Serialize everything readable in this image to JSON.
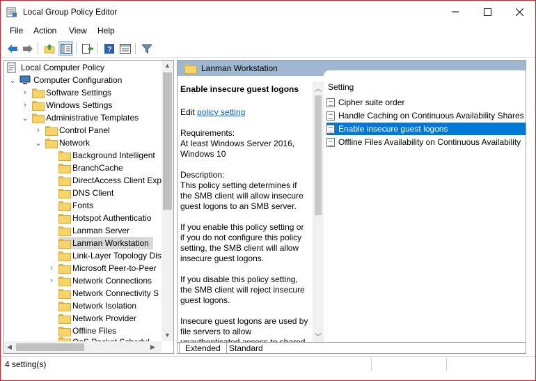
{
  "window": {
    "title": "Local Group Policy Editor"
  },
  "menu": [
    "File",
    "Action",
    "View",
    "Help"
  ],
  "toolbar": {
    "icons": [
      "back-icon",
      "forward-icon",
      "up-folder-icon",
      "show-hide-tree-icon",
      "export-list-icon",
      "help-icon",
      "properties-icon",
      "filter-icon"
    ]
  },
  "tree": {
    "root": "Local Computer Policy",
    "computer_config": "Computer Configuration",
    "software_settings": "Software Settings",
    "windows_settings": "Windows Settings",
    "admin_templates": "Administrative Templates",
    "control_panel": "Control Panel",
    "network": "Network",
    "items": [
      "Background Intelligent",
      "BranchCache",
      "DirectAccess Client Exp",
      "DNS Client",
      "Fonts",
      "Hotspot Authenticatio",
      "Lanman Server",
      "Lanman Workstation",
      "Link-Layer Topology Dis",
      "Microsoft Peer-to-Peer",
      "Network Connections",
      "Network Connectivity S",
      "Network Isolation",
      "Network Provider",
      "Offline Files",
      "QoS Packet Schedul"
    ]
  },
  "right": {
    "header": "Lanman Workstation",
    "desc": {
      "title": "Enable insecure guest logons",
      "edit_prefix": "Edit",
      "edit_link": "policy setting",
      "requirements_label": "Requirements:",
      "requirements_text": "At least Windows Server 2016, Windows 10",
      "description_label": "Description:",
      "p1": "This policy setting determines if the SMB client will allow insecure guest logons to an SMB server.",
      "p2": "If you enable this policy setting or if you do not configure this policy setting, the SMB client will allow insecure guest logons.",
      "p3": "If you disable this policy setting, the SMB client will reject insecure guest logons.",
      "p4": "Insecure guest logons are used by file servers to allow unauthenticated access to shared"
    },
    "column_header": "Setting",
    "settings": [
      "Cipher suite order",
      "Handle Caching on Continuous Availability Shares",
      "Enable insecure guest logons",
      "Offline Files Availability on Continuous Availability"
    ],
    "tabs": [
      "Extended",
      "Standard"
    ]
  },
  "status": {
    "text": "4 setting(s)"
  },
  "colors": {
    "selection": "#0078d7",
    "header": "#9fb7d0",
    "folder": "#f7d467"
  }
}
